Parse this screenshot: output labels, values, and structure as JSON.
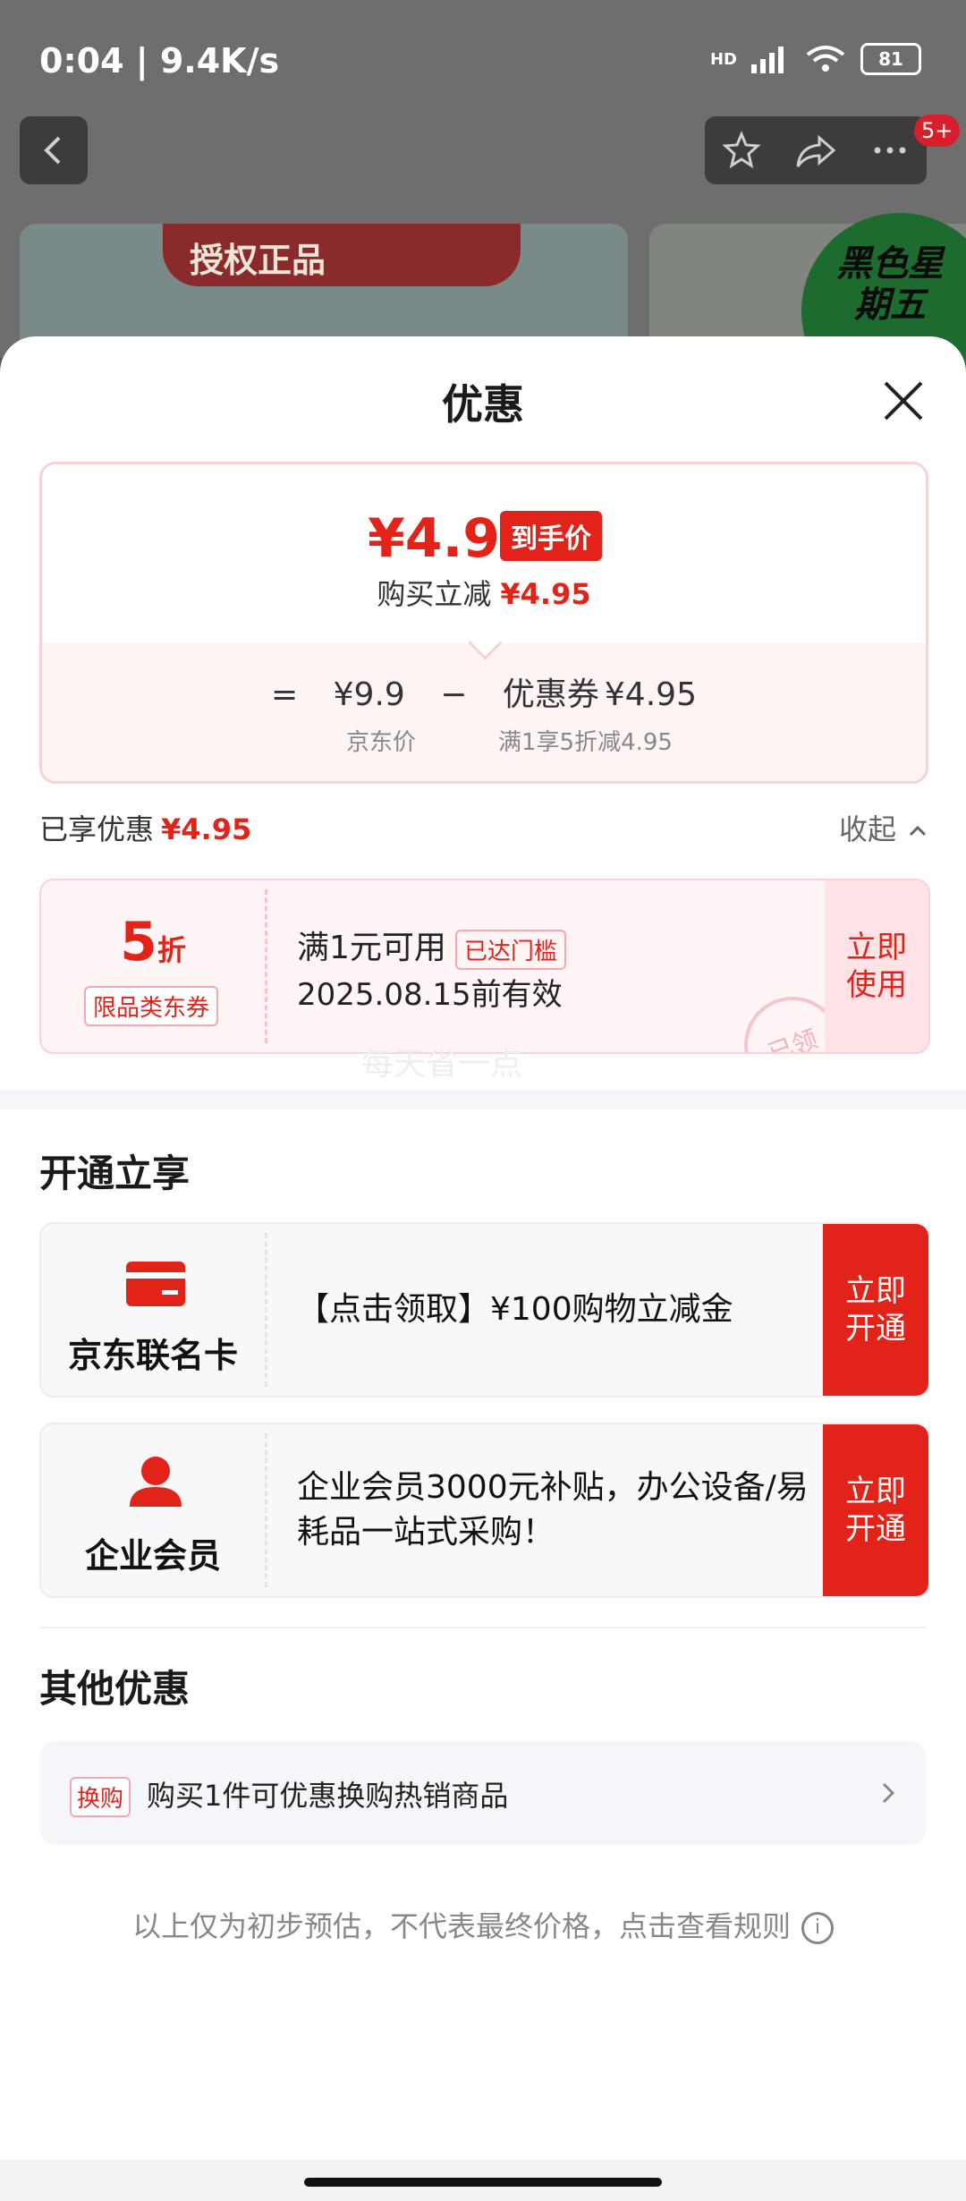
{
  "status_bar": {
    "time_speed": "0:04 | 9.4K/s",
    "battery": "81",
    "network": "HD"
  },
  "nav": {
    "badge": "5+"
  },
  "banner": {
    "brand_text": "授权正品",
    "promo_text": "黑色星期五"
  },
  "sheet": {
    "title": "优惠",
    "price": {
      "final": "¥4.95",
      "final_tag": "到手价",
      "buy_reduce_label": "购买立减",
      "buy_reduce_value": "¥4.95",
      "eq": "=",
      "jd_price": "¥9.9",
      "minus": "−",
      "coupon_label": "优惠券",
      "coupon_value": "¥4.95",
      "jd_price_label": "京东价",
      "coupon_rule": "满1享5折减4.95"
    },
    "enjoyed": {
      "label": "已享优惠",
      "value": "¥4.95",
      "collapse": "收起"
    },
    "coupon": {
      "discount": "5",
      "discount_unit": "折",
      "type": "限品类东券",
      "condition": "满1元可用",
      "threshold_tag": "已达门槛",
      "expiry": "2025.08.15前有效",
      "use_btn_line1": "立即",
      "use_btn_line2": "使用",
      "stamp": "已领",
      "watermark": "每天省一点"
    },
    "open_section": {
      "title": "开通立享",
      "items": [
        {
          "name": "京东联名卡",
          "desc": "【点击领取】¥100购物立减金",
          "btn_line1": "立即",
          "btn_line2": "开通"
        },
        {
          "name": "企业会员",
          "desc": "企业会员3000元补贴，办公设备/易耗品一站式采购！",
          "btn_line1": "立即",
          "btn_line2": "开通"
        }
      ]
    },
    "other_section": {
      "title": "其他优惠",
      "swap_tag": "换购",
      "swap_text": "购买1件可优惠换购热销商品"
    },
    "footnote": "以上仅为初步预估，不代表最终价格，点击查看规则",
    "colors": {
      "accent": "#e2231a",
      "soft_pink": "#fff5f6"
    }
  }
}
